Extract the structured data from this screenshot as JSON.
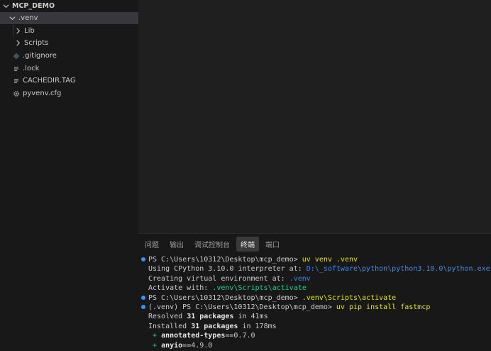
{
  "explorer": {
    "root_label": "MCP_DEMO",
    "items": [
      {
        "label": ".venv",
        "icon": "chevron-down"
      },
      {
        "label": "Lib",
        "icon": "chevron-right"
      },
      {
        "label": "Scripts",
        "icon": "chevron-right"
      },
      {
        "label": ".gitignore",
        "icon": "git-icon"
      },
      {
        "label": ".lock",
        "icon": "lines-icon"
      },
      {
        "label": "CACHEDIR.TAG",
        "icon": "lines-icon"
      },
      {
        "label": "pyvenv.cfg",
        "icon": "gear-icon"
      }
    ]
  },
  "panel": {
    "tabs": [
      {
        "label": "问题"
      },
      {
        "label": "输出"
      },
      {
        "label": "调试控制台"
      },
      {
        "label": "终端"
      },
      {
        "label": "端口"
      }
    ],
    "active_tab": "终端"
  },
  "terminal": {
    "l1_prompt": "PS C:\\Users\\10312\\Desktop\\mcp_demo> ",
    "l1_cmd": "uv venv .venv",
    "l2_text": "Using CPython 3.10.0 interpreter at: ",
    "l2_path": "D:\\_software\\python\\python3.10.0\\python.exe",
    "l3_text": "Creating virtual environment at: ",
    "l3_path": ".venv",
    "l4_text": "Activate with: ",
    "l4_path": ".venv\\Scripts\\activate",
    "l5_prompt": "PS C:\\Users\\10312\\Desktop\\mcp_demo> ",
    "l5_cmd": ".venv\\Scripts\\activate",
    "l6_prompt": "(.venv) PS C:\\Users\\10312\\Desktop\\mcp_demo> ",
    "l6_cmd": "uv pip install fastmcp",
    "l7_a": "Resolved ",
    "l7_b": "31 packages",
    "l7_c": " in 41ms",
    "l8_a": "Installed ",
    "l8_b": "31 packages",
    "l8_c": " in 178ms",
    "l9_plus": " + ",
    "l9_pkg": "annotated-types",
    "l9_ver": "==0.7.0",
    "l10_plus": " + ",
    "l10_pkg": "anyio",
    "l10_ver": "==4.9.0"
  },
  "colors": {
    "accent": "#3794ff",
    "command": "#e5e510",
    "path": "#3b8eea",
    "activate": "#23d18b"
  }
}
